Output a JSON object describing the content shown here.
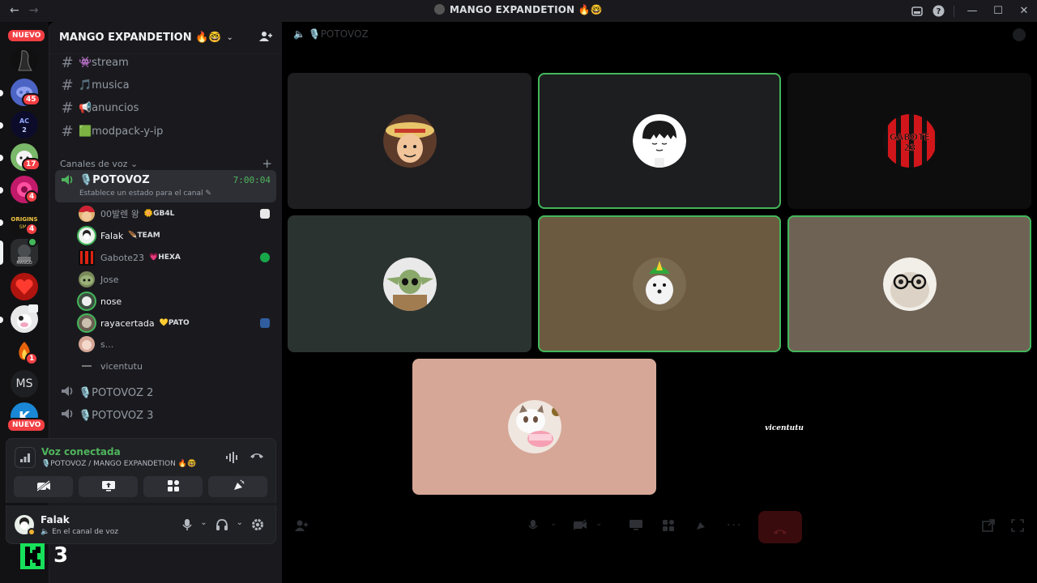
{
  "titlebar": {
    "back": "←",
    "forward": "→",
    "title": "MANGO EXPANDETION 🔥🤓",
    "inbox_icon": "inbox-icon",
    "help_icon": "help-icon",
    "minimize": "—",
    "maximize": "☐",
    "close": "✕"
  },
  "rail": {
    "nuevo_top": "NUEVO",
    "nuevo_bottom": "NUEVO",
    "badges": [
      "45",
      "17",
      "4",
      "4",
      "1"
    ],
    "ms_label": "MS",
    "origins_label": "ORIGINS SMP"
  },
  "guild": {
    "name": "MANGO EXPANDETION 🔥🤓",
    "chevron": "⌄",
    "invite_icon": "add-member-icon"
  },
  "text_channels": [
    {
      "name": "👾stream"
    },
    {
      "name": "🎵musica"
    },
    {
      "name": "📢anuncios"
    },
    {
      "name": "🟩modpack-y-ip"
    }
  ],
  "voice_category": {
    "label": "Canales de voz ⌄",
    "add": "+"
  },
  "active_voice": {
    "name": "🎙️POTOVOZ",
    "timer": "7:00:04",
    "status": "Establece un estado para el canal ✎"
  },
  "members": [
    {
      "name": "00발렌 왕",
      "tag": "🌼GB4L"
    },
    {
      "name": "Falak",
      "tag": "🪶TEAM"
    },
    {
      "name": "Gabote23",
      "tag": "💗HEXA"
    },
    {
      "name": "Jose",
      "tag": ""
    },
    {
      "name": "nose",
      "tag": ""
    },
    {
      "name": "rayacertada",
      "tag": "💛PATO"
    },
    {
      "name": "s...",
      "tag": ""
    },
    {
      "name": "vicentutu",
      "tag": ""
    }
  ],
  "other_voice": [
    {
      "name": "🎙️POTOVOZ 2"
    },
    {
      "name": "🎙️POTOVOZ 3"
    }
  ],
  "voice_panel": {
    "title": "Voz conectada",
    "subtitle": "🎙️POTOVOZ / MANGO EXPANDETION 🔥🤓",
    "buttons": [
      "camera-off-icon",
      "screen-share-icon",
      "activities-icon",
      "soundboard-icon"
    ]
  },
  "user_panel": {
    "name": "Falak",
    "status": "🔈 En el canal de voz"
  },
  "overlay": {
    "number": "3"
  },
  "stage": {
    "channel": "🔈 🎙️POTOVOZ",
    "tiles": [
      {
        "user": "00발렌 왕",
        "bg": "#1e1e21",
        "speaking": false
      },
      {
        "user": "Falak",
        "bg": "#1d1e1f",
        "speaking": true
      },
      {
        "user": "Gabote23",
        "bg": "#0d0d0e",
        "speaking": false,
        "label": "GABOTE 23"
      },
      {
        "user": "Jose",
        "bg": "#2b3330",
        "speaking": false
      },
      {
        "user": "nose",
        "bg": "#6b5a40",
        "speaking": true
      },
      {
        "user": "rayacertada",
        "bg": "#6e6255",
        "speaking": true
      },
      {
        "user": "s...",
        "bg": "#d6a797",
        "speaking": false
      },
      {
        "user": "vicentutu",
        "bg": "#000000",
        "speaking": false,
        "label": "vicentutu"
      }
    ]
  },
  "colors": {
    "accent_green": "#43b65a",
    "badge_red": "#f23f43"
  }
}
